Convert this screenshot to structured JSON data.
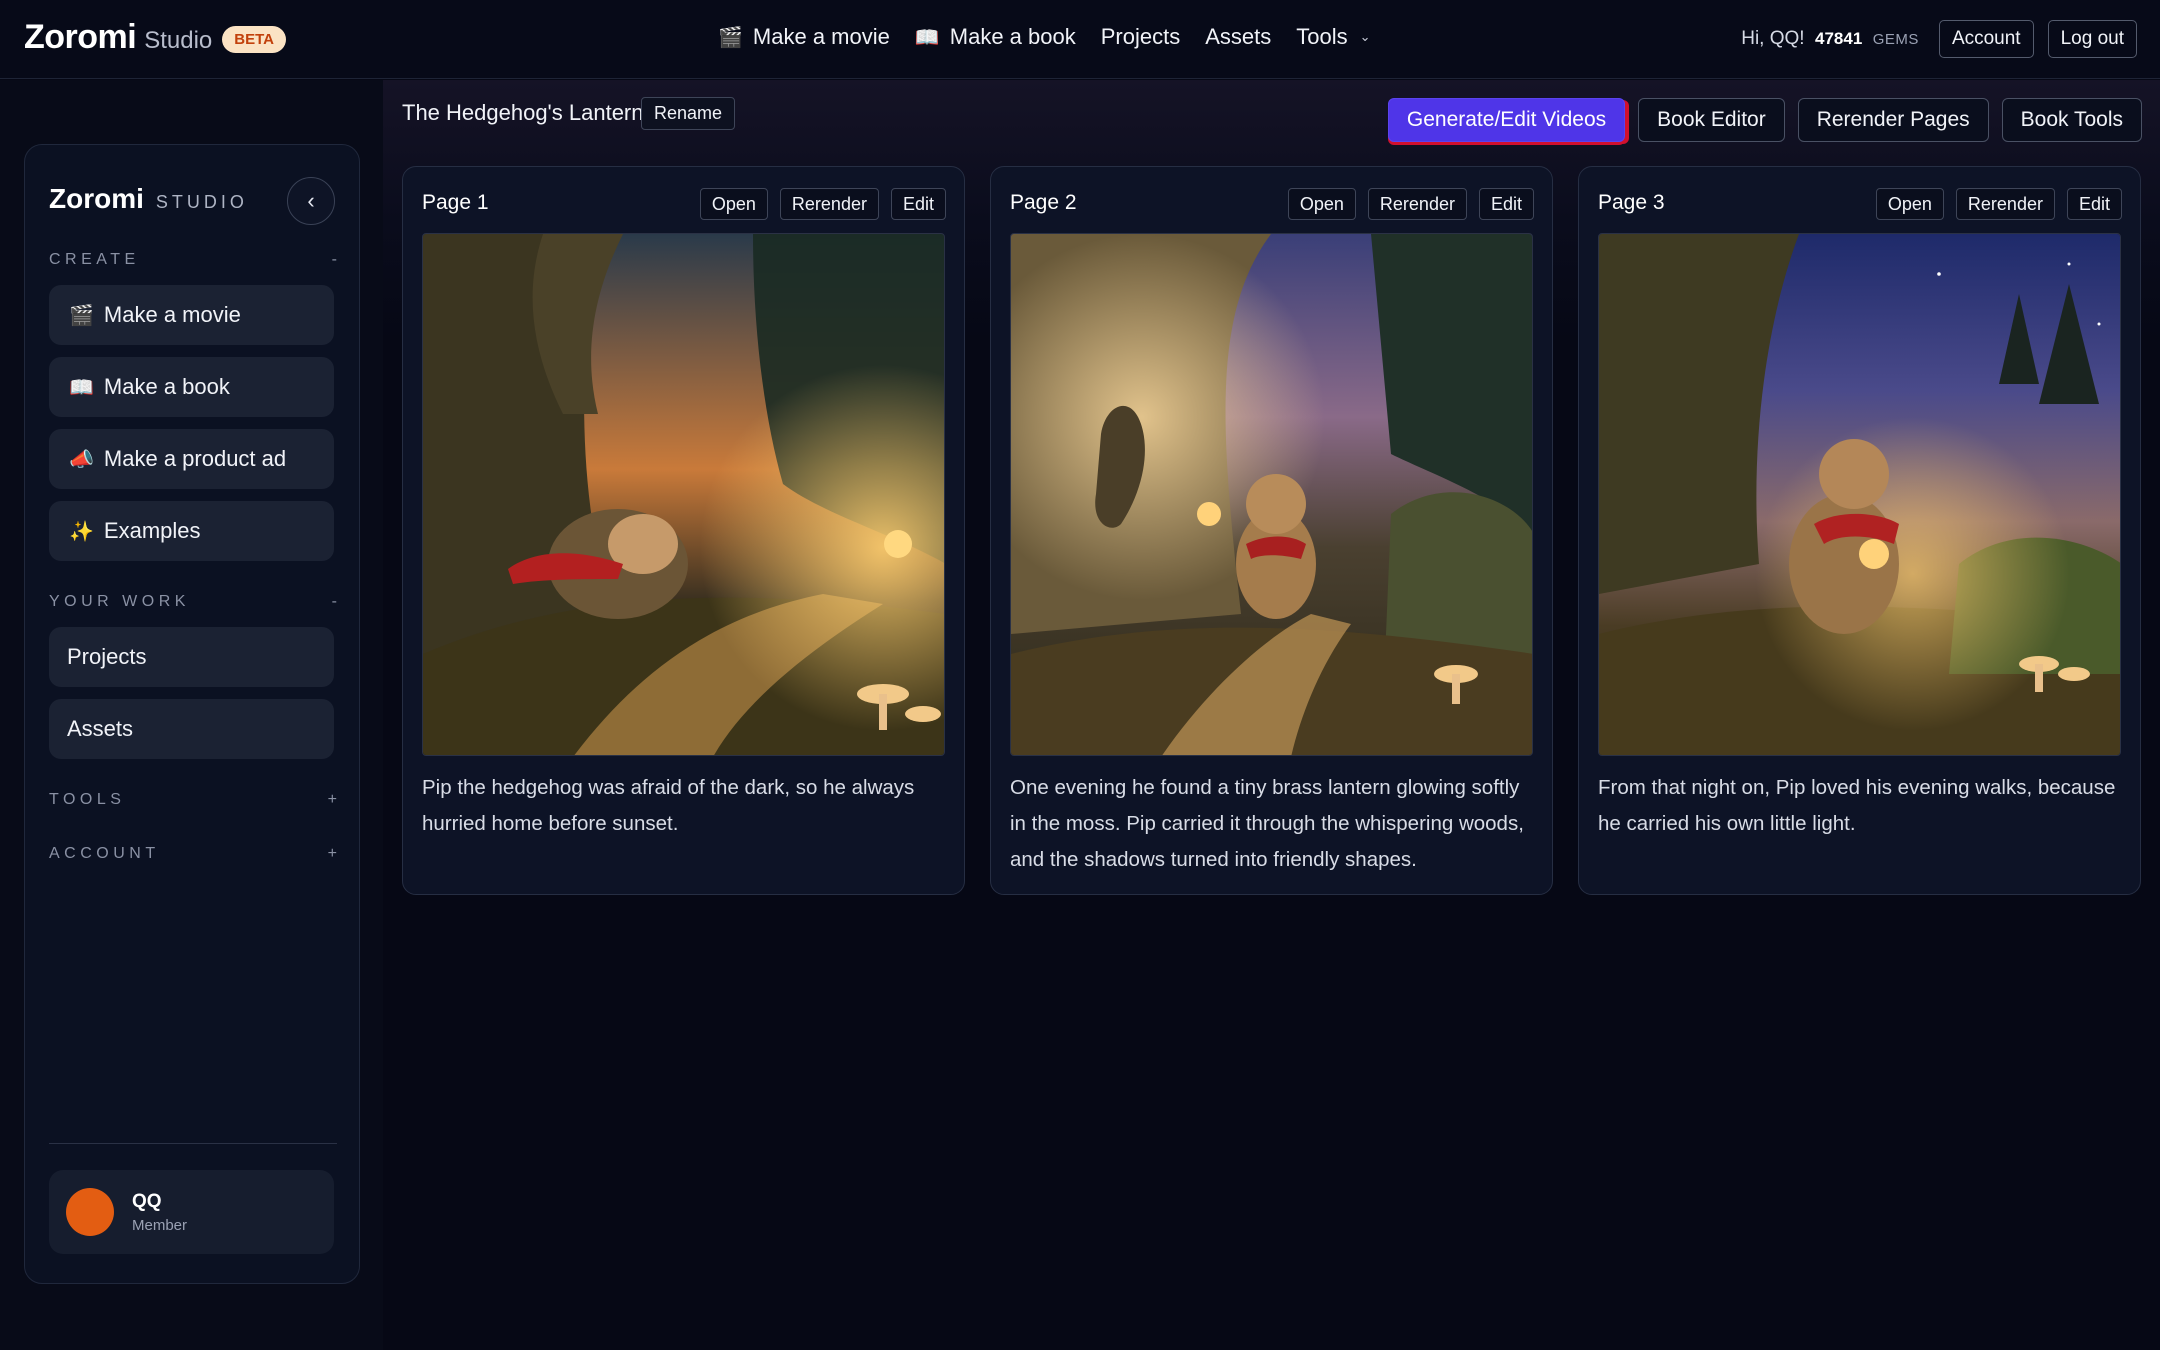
{
  "app": {
    "brand_name": "Zoromi",
    "brand_sub": "Studio",
    "beta": "BETA"
  },
  "topnav": {
    "items": [
      {
        "icon": "clapper-icon",
        "glyph": "🎬",
        "label": "Make a movie"
      },
      {
        "icon": "book-icon",
        "glyph": "📖",
        "label": "Make a book"
      },
      {
        "label": "Projects"
      },
      {
        "label": "Assets"
      },
      {
        "label": "Tools",
        "chevron": "⌄"
      }
    ]
  },
  "user_bar": {
    "greeting": "Hi, QQ!",
    "gems_value": "47841",
    "gems_unit": "GEMS",
    "account": "Account",
    "logout": "Log out"
  },
  "sidebar": {
    "brand_name": "Zoromi",
    "brand_sub": "STUDIO",
    "collapse_glyph": "‹",
    "sections": {
      "create": {
        "label": "CREATE",
        "toggle": "-"
      },
      "your_work": {
        "label": "YOUR WORK",
        "toggle": "-"
      },
      "tools": {
        "label": "TOOLS",
        "toggle": "+"
      },
      "account": {
        "label": "ACCOUNT",
        "toggle": "+"
      }
    },
    "create_items": [
      {
        "glyph": "🎬",
        "label": "Make a movie"
      },
      {
        "glyph": "📖",
        "label": "Make a book"
      },
      {
        "glyph": "📣",
        "label": "Make a product ad"
      },
      {
        "glyph": "✨",
        "label": "Examples"
      }
    ],
    "work_items": [
      {
        "label": "Projects"
      },
      {
        "label": "Assets"
      }
    ],
    "user": {
      "name": "QQ",
      "role": "Member",
      "avatar_color": "#e35d12"
    }
  },
  "project": {
    "title": "The Hedgehog's Lantern",
    "rename": "Rename"
  },
  "toolbar": {
    "generate": "Generate/Edit Videos",
    "book_editor": "Book Editor",
    "rerender_pages": "Rerender Pages",
    "book_tools": "Book Tools"
  },
  "card_actions": {
    "open": "Open",
    "rerender": "Rerender",
    "edit": "Edit"
  },
  "pages": [
    {
      "title": "Page 1",
      "text": "Pip the hedgehog was afraid of the dark, so he always hurried home before sunset."
    },
    {
      "title": "Page 2",
      "text": "One evening he found a tiny brass lantern glowing softly in the moss. Pip carried it through the whispering woods, and the shadows turned into friendly shapes."
    },
    {
      "title": "Page 3",
      "text": "From that night on, Pip loved his evening walks, because he carried his own little light."
    }
  ],
  "colors": {
    "background": "#060815",
    "primary_button": "#4f35e8",
    "highlight": "#d1102e",
    "beta_badge": "#fbe3c4"
  }
}
